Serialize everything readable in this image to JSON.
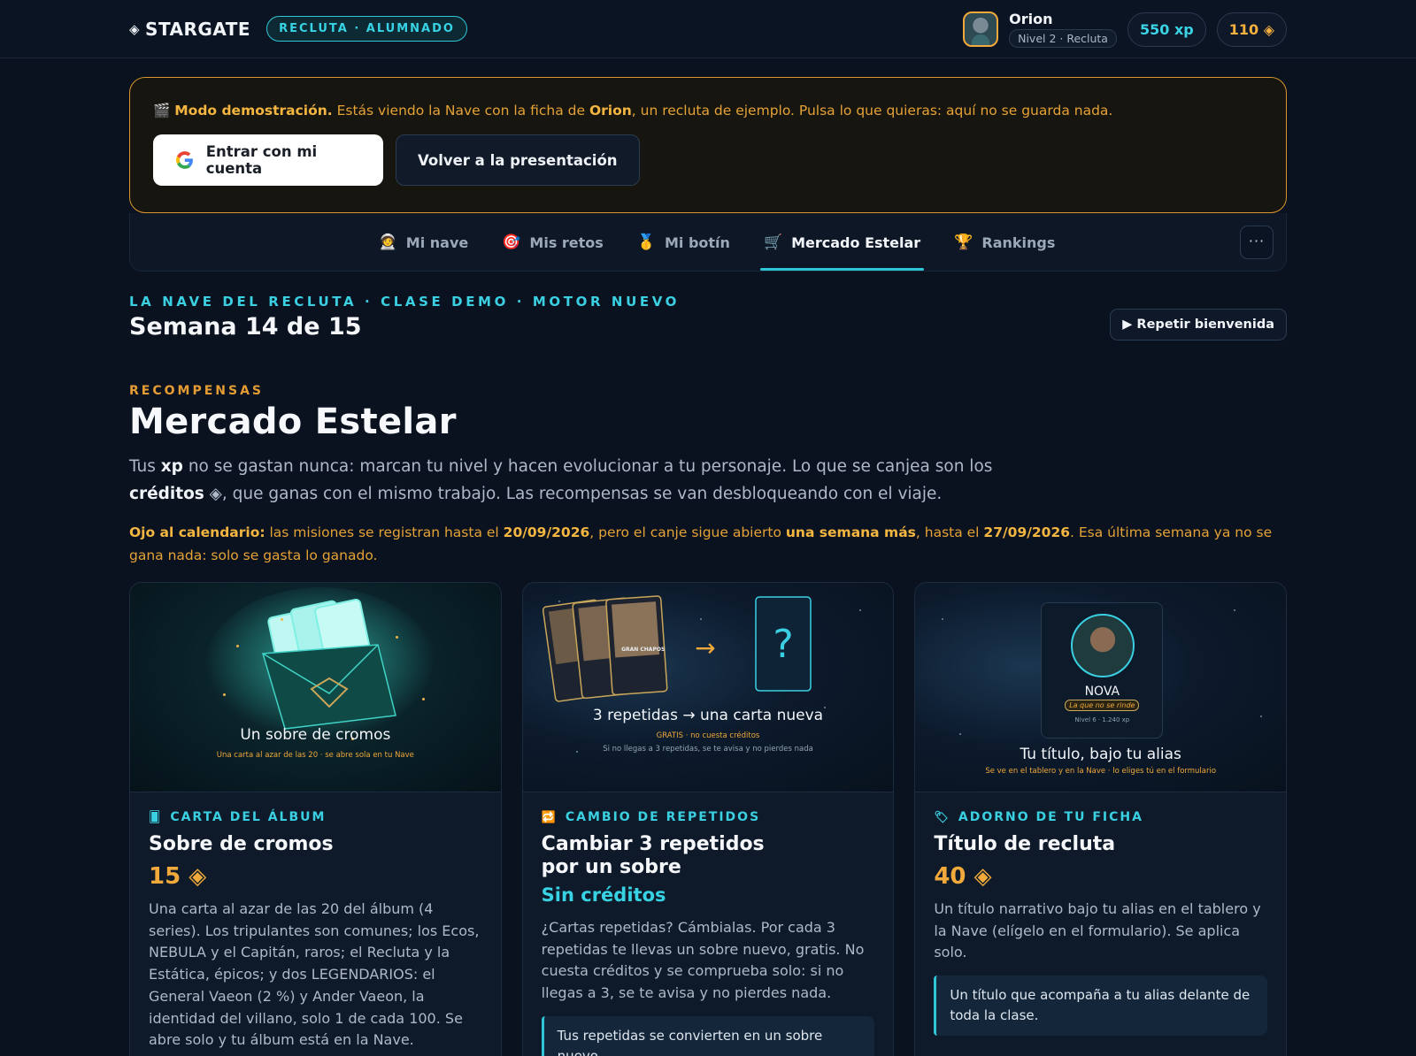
{
  "topbar": {
    "brand": "STARGATE",
    "role_pill": "RECLUTA · ALUMNADO",
    "user_name": "Orion",
    "user_level": "Nivel 2 · Recluta",
    "xp": "550 xp",
    "credits": "110 ◈"
  },
  "demo": {
    "icon": "🎬",
    "lead_bold": "Modo demostración.",
    "text_1": " Estás viendo la Nave con la ficha de ",
    "name_bold": "Orion",
    "text_2": ", un recluta de ejemplo. Pulsa lo que quieras: aquí no se guarda nada.",
    "login_button": "Entrar con mi cuenta",
    "back_button": "Volver a la presentación"
  },
  "tabs": [
    {
      "icon": "🧑‍🚀",
      "label": "Mi nave"
    },
    {
      "icon": "🎯",
      "label": "Mis retos"
    },
    {
      "icon": "🥇",
      "label": "Mi botín"
    },
    {
      "icon": "🛒",
      "label": "Mercado Estelar",
      "active": true
    },
    {
      "icon": "🏆",
      "label": "Rankings"
    }
  ],
  "more_button": "···",
  "header": {
    "kicker": "LA NAVE DEL RECLUTA · CLASE DEMO · MOTOR NUEVO",
    "week": "Semana 14 de 15",
    "replay_button": "▶ Repetir bienvenida"
  },
  "section": {
    "kicker": "RECOMPENSAS",
    "title": "Mercado Estelar",
    "lead_1": "Tus ",
    "lead_xp": "xp",
    "lead_2": " no se gastan nunca: marcan tu nivel y hacen evolucionar a tu personaje. Lo que se canjea son los ",
    "lead_credits": "créditos",
    "lead_3": " ◈, que ganas con el mismo trabajo. Las recompensas se van desbloqueando con el viaje.",
    "warn_bold": "Ojo al calendario:",
    "warn_1": " las misiones se registran hasta el ",
    "warn_date1": "20/09/2026",
    "warn_2": ", pero el canje sigue abierto ",
    "warn_week": "una semana más",
    "warn_3": ", hasta el ",
    "warn_date2": "27/09/2026",
    "warn_4": ". Esa última semana ya no se gana nada: solo se gasta lo ganado."
  },
  "cards": [
    {
      "img_caption": "Un sobre de cromos",
      "img_sub": "Una carta al azar de las 20 · se abre sola en tu Nave",
      "cat_icon": "🂠",
      "category": "CARTA DEL ÁLBUM",
      "title": "Sobre de cromos",
      "price": "15 ◈",
      "desc": "Una carta al azar de las 20 del álbum (4 series). Los tripulantes son comunes; los Ecos, NEBULA y el Capitán, raros; el Recluta y la Estática, épicos; y dos LEGENDARIOS: el General Vaeon (2 %) y Ander Vaeon, la identidad del villano, solo 1 de cada 100. Se abre solo y tu álbum está en la Nave."
    },
    {
      "img_caption": "3 repetidas → una carta nueva",
      "img_sub1": "GRATIS · no cuesta créditos",
      "img_sub2": "Si no llegas a 3 repetidas, se te avisa y no pierdes nada",
      "mini_card_label": "GRAN CHAPOS",
      "cat_icon": "🔁",
      "category": "CAMBIO DE REPETIDOS",
      "title": "Cambiar 3 repetidos por un sobre",
      "price": "Sin créditos",
      "desc": "¿Cartas repetidas? Cámbialas. Por cada 3 repetidas te llevas un sobre nuevo, gratis. No cuesta créditos y se comprueba solo: si no llegas a 3, se te avisa y no pierdes nada.",
      "note": "Tus repetidas se convierten en un sobre nuevo."
    },
    {
      "img_caption": "Tu título, bajo tu alias",
      "img_sub": "Se ve en el tablero y en la Nave · lo eliges tú en el formulario",
      "profile_name": "NOVA",
      "profile_title": "La que no se rinde",
      "profile_level": "Nivel 6 · 1.240 xp",
      "cat_icon": "🏷",
      "category": "ADORNO DE TU FICHA",
      "title": "Título de recluta",
      "price": "40 ◈",
      "desc": "Un título narrativo bajo tu alias en el tablero y la Nave (elígelo en el formulario). Se aplica solo.",
      "note": "Un título que acompaña a tu alias delante de toda la clase."
    }
  ],
  "colors": {
    "accent_cyan": "#2fc5d6",
    "accent_amber": "#f0a93a",
    "background": "#0a1220"
  }
}
